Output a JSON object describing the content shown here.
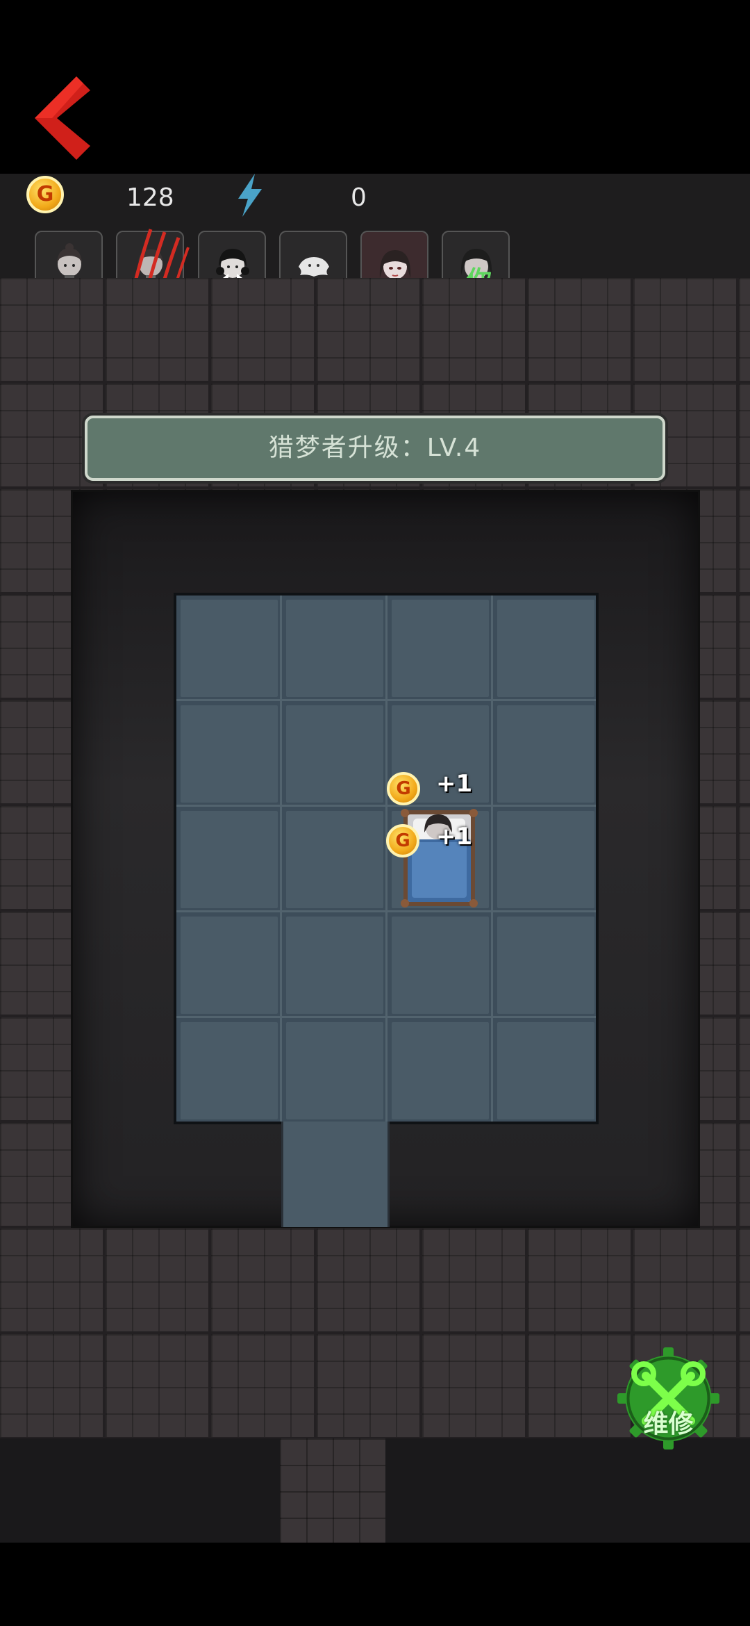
{
  "status": {
    "coins": "128",
    "coin_icon_letter": "G",
    "energy": "0"
  },
  "avatars": [
    {
      "name": "girl-avatar",
      "selected": false
    },
    {
      "name": "scratched-avatar",
      "selected": false
    },
    {
      "name": "bun-hair-avatar",
      "selected": false
    },
    {
      "name": "ghost-avatar",
      "selected": false
    },
    {
      "name": "dark-hair-avatar",
      "selected": true
    },
    {
      "name": "player-avatar",
      "selected": false,
      "label": "你"
    }
  ],
  "banner": {
    "text": "猎梦者升级：LV.4"
  },
  "room": {
    "coin_popups": [
      {
        "letter": "G",
        "text": "+1"
      },
      {
        "letter": "G",
        "text": "+1"
      }
    ]
  },
  "repair": {
    "label": "维修"
  },
  "colors": {
    "back_arrow": "#d0201a",
    "energy_bolt": "#4aa3c8",
    "you_label": "#5ed65e",
    "repair_bg": "#2f9e2f",
    "banner_bg": "#60786c"
  }
}
